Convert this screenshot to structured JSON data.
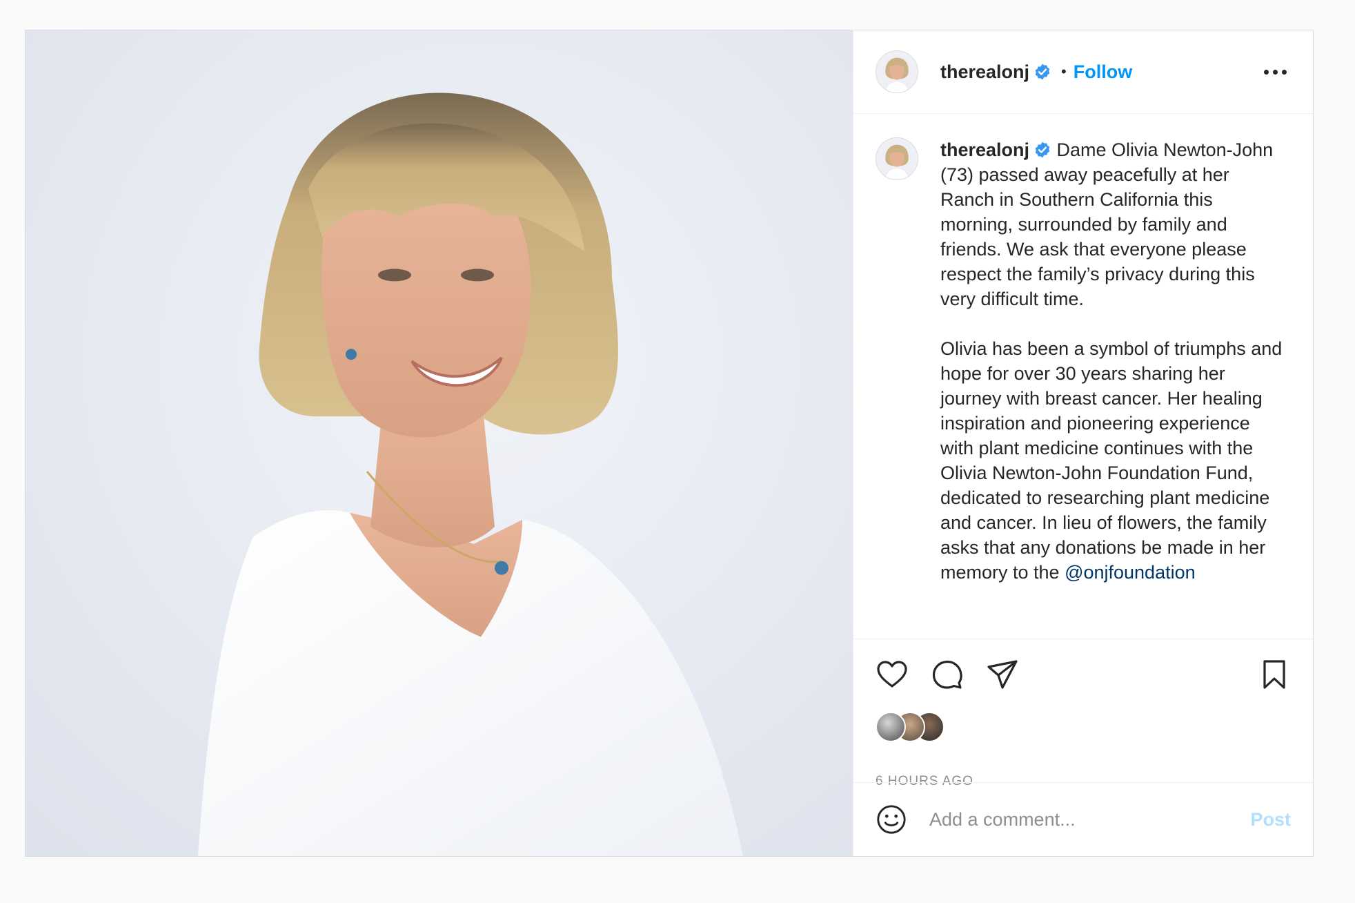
{
  "post": {
    "username": "therealonj",
    "follow_label": "Follow",
    "separator": "•",
    "caption_p1": " Dame Olivia Newton-John (73) passed away peacefully at her Ranch in Southern California this morning, surrounded by family and friends. We ask that everyone please respect the family’s privacy during this very difficult time.",
    "caption_p2": "Olivia has been a symbol of triumphs and hope for over 30 years sharing her journey with breast cancer. Her healing inspiration and pioneering experience with plant medicine continues with the Olivia Newton-John Foundation Fund, dedicated to researching plant medicine and cancer. In lieu of flowers, the family asks that any donations be made in her memory to the ",
    "mention": "@onjfoundation",
    "timestamp": "6 HOURS AGO",
    "comment_placeholder": "Add a comment...",
    "post_label": "Post"
  },
  "icons": {
    "verified": "verified-badge-icon",
    "more": "more-options-icon",
    "like": "heart-icon",
    "comment": "comment-bubble-icon",
    "share": "paper-plane-icon",
    "save": "bookmark-icon",
    "emoji": "smiley-icon"
  },
  "colors": {
    "link": "#0095f6",
    "mention": "#00376b",
    "verified": "#3897f0",
    "muted": "#8e8e8e",
    "post_disabled": "#b2dffc"
  }
}
